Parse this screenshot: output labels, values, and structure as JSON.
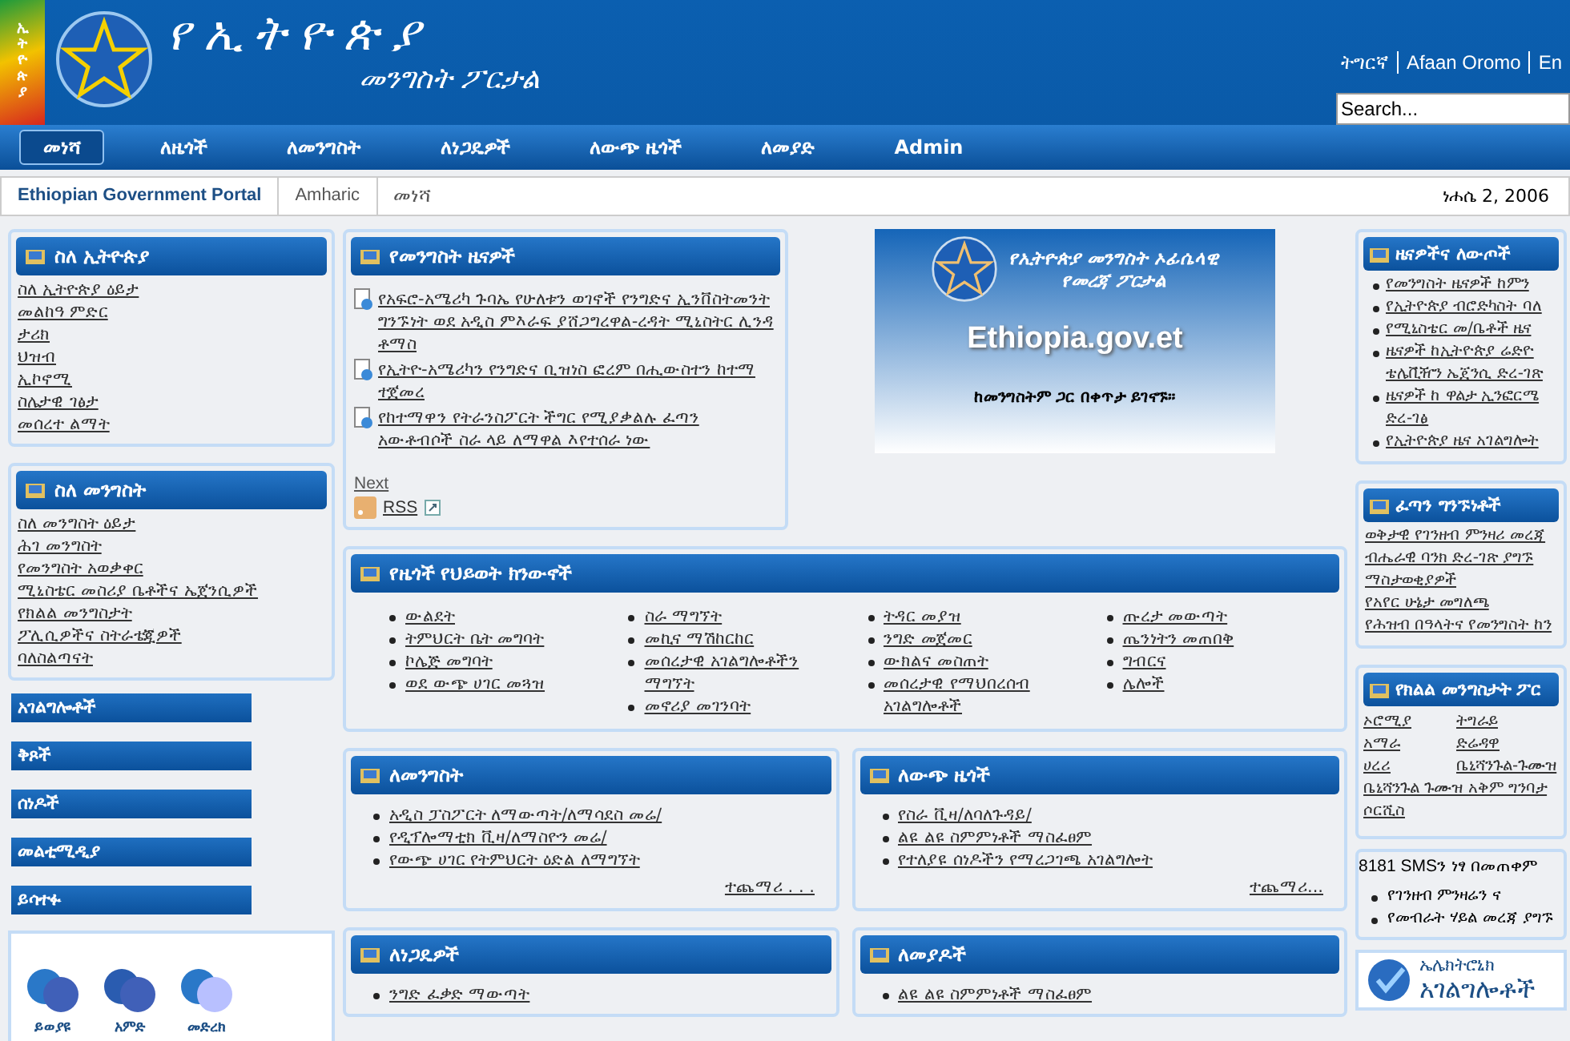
{
  "header": {
    "logo_text": "ኢትዮጵያ",
    "title": "የኢትዮጵያ",
    "subtitle": "መንግስት ፖርታል",
    "languages": [
      "ትግርኛ",
      "Afaan Oromo",
      "En"
    ],
    "search": {
      "placeholder": "Search..."
    }
  },
  "nav": [
    {
      "label": "መነሻ",
      "selected": true
    },
    {
      "label": "ለዜጎች",
      "selected": false
    },
    {
      "label": "ለመንግስት",
      "selected": false
    },
    {
      "label": "ለነጋዴዎች",
      "selected": false
    },
    {
      "label": "ለውጭ ዜጎች",
      "selected": false
    },
    {
      "label": "ለመያድ",
      "selected": false
    },
    {
      "label": "Admin",
      "selected": false
    }
  ],
  "breadcrumb": [
    "Ethiopian Government Portal",
    "Amharic",
    "መነሻ"
  ],
  "date": "ነሐሴ 2, 2006",
  "left": {
    "boxes": [
      {
        "title": "ስለ ኢትዮጵያ",
        "links": [
          "ስለ ኢትዮጵያ ዕይታ",
          "መልከዓ ምድር",
          "ታሪክ",
          "ህዝብ",
          "ኢኮኖሚ",
          "ስሌታዊ ገፅታ",
          "መሰረተ ልማት"
        ]
      },
      {
        "title": "ስለ መንግስት",
        "links": [
          "ስለ መንግስት ዕይታ",
          "ሕገ መንግስት",
          "የመንግስት አወቃቀር",
          "ሚኒስቴር መስሪያ ቤቶችና ኤጀንሲዎች",
          "የክልል መንግስታት",
          "ፖሊሲዎችና ስትራቴጂዎች",
          "ባለስልጣናት"
        ]
      }
    ],
    "menu": [
      "አገልግሎቶች",
      "ቅጾች",
      "ሰነዶች",
      "መልቲሚዲያ",
      "ይሳተፉ"
    ],
    "tools": [
      "ይወያዩ",
      "አምድ",
      "መድረክ"
    ]
  },
  "news": {
    "title": "የመንግስት ዜናዎች",
    "items": [
      "የአፍሮ-አሜሪካ ጉባኤ የሁለቱን ወገኖች የንግድና ኢንቨስትመንት ግንኙነት ወደ አዲስ ምእራፍ ያሸጋግረዋል-ረዳት ሚኒስትር ሊንዳ ቶማስ",
      "የኢትዮ-አሜሪካን የንግድና ቢዝነስ ፎረም በሒውስተን ከተማ ተጀመረ",
      "የከተማዋን የትራንስፖርት ችግር የሚያቃልሉ ፈጣን አውቶብሶች ስራ ላይ ለማዋል እየተሰራ ነው"
    ],
    "next": "Next",
    "rss": "RSS"
  },
  "banner": {
    "line1": "የኢትዮጵያ መንግስት ኦፊሴላዊ",
    "line2": "የመረጃ ፖርታል",
    "domain": "Ethiopia.gov.et",
    "tagline": "ከመንግስትም ጋር በቀጥታ ይገናኙ።"
  },
  "life_events": {
    "title": "የዜጎች የህይወት ክንውኖች",
    "columns": [
      [
        "ውልደት",
        "ትምህርት ቤት መግባት",
        "ኮሌጅ መግባት",
        "ወደ ውጭ ሀገር መጓዝ"
      ],
      [
        "ስራ ማግኘት",
        "መኪና ማሽከርከር",
        "መሰረታዊ አገልግሎቶችን ማግኘት",
        "መኖሪያ መገንባት"
      ],
      [
        "ትዳር መያዝ",
        "ንግድ መጀመር",
        "ውክልና መስጠት",
        "መሰረታዊ የማህበረሰብ አገልግሎቶች"
      ],
      [
        "ጡረታ መውጣት",
        "ጤንነትን መጠበቅ",
        "ግብርና",
        "ሌሎች"
      ]
    ]
  },
  "sections": [
    {
      "title": "ለመንግስት",
      "items": [
        "አዲስ ፓስፖርት ለማውጣት/ለማሳደስ መሬ/",
        "የዲፕሎማቲክ ቪዛ/ለማስዮን መሬ/",
        "የውጭ ሀገር የትምህርት ዕድል ለማግኘት"
      ],
      "more": "ተጨማሪ . . ."
    },
    {
      "title": "ለውጭ ዜጎች",
      "items": [
        "የስራ ቪዛ/ለባለጉዳይ/",
        "ልዩ ልዩ ስምምነቶች ማስፈፀም",
        "የተለያዩ ሰነዶችን የማረጋገጫ አገልግሎት"
      ],
      "more": "ተጨማሪ..."
    },
    {
      "title": "ለነጋዴዎች",
      "items": [
        "ንግድ ፈቃድ ማውጣት"
      ]
    },
    {
      "title": "ለመያዶች",
      "items": [
        "ልዩ ልዩ ስምምነቶች ማስፈፀም"
      ]
    }
  ],
  "right": {
    "news": {
      "title": "ዜናዎችና ለውጦች",
      "items": [
        "የመንግስት ዜናዎች ከምን",
        "የኢትዮጵያ ብሮድካስት ባለ",
        "የሚኒስቴር መ/ቤቶች ዜና",
        "ዜናዎች ከኢትዮጵያ ሬድዮ\nቴሌቪዥን ኤጀንሲ ድረ-ገጽ",
        "ዜናዎች ከ ዋልታ ኢንፎርሜ\nድረ-ገፅ",
        "የኢትዮጵያ ዜና አገልግሎት"
      ]
    },
    "quick_links": {
      "title": "ፈጣን ግንኙነቶች",
      "links": [
        "ወቅታዊ የገንዘብ ምንዛሪ መረጃ",
        "ብሔራዊ ባንክ ድረ-ገጽ ያግኙ",
        "ማስታወቂያዎች",
        "የአየር ሁኔታ መግለጫ",
        "የሕዝብ በዓላትና የመንግስት ከን"
      ]
    },
    "regions": {
      "title": "የክልል መንግስታት ፖር",
      "links": [
        "ኦሮሚያ",
        "ትግራይ",
        "አማራ",
        "ድሬዳዋ",
        "ሀረሪ",
        "ቤኒሻንጉል-ጉሙዝ",
        "ቤኒሻንጉል ጉሙዝ አቅም ግንባታ",
        "ሶርሺስ"
      ]
    },
    "sms": {
      "title": "8181 SMSን ነፃ በመጠቀም",
      "items": [
        "የገንዘብ ምንዛሬን ና",
        "የመብራት ሃይል መረጃ ያግኙ"
      ]
    },
    "eservices": {
      "line1": "ኤሌክትሮኒክ",
      "line2": "አገልግሎቶች"
    }
  }
}
